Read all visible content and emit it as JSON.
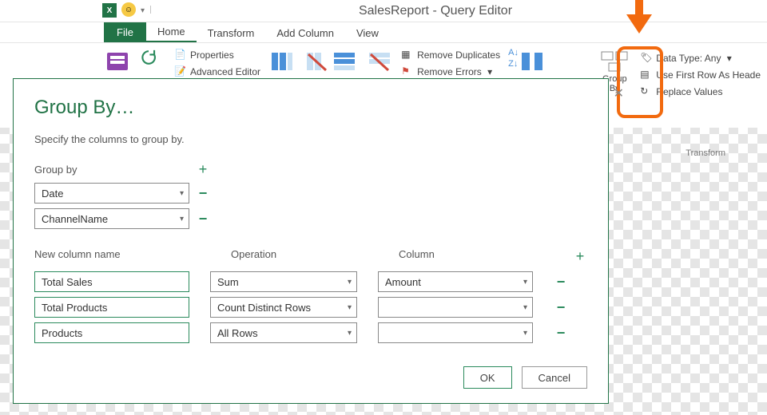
{
  "window": {
    "title": "SalesReport - Query Editor"
  },
  "tabs": {
    "file": "File",
    "home": "Home",
    "transform": "Transform",
    "add_column": "Add Column",
    "view": "View"
  },
  "ribbon": {
    "properties": "Properties",
    "advanced_editor": "Advanced Editor",
    "remove_duplicates": "Remove Duplicates",
    "remove_errors": "Remove Errors",
    "group_by": "Group\nBy",
    "data_type": "Data Type: Any",
    "use_first_row": "Use First Row As Heade",
    "replace_values": "Replace Values",
    "transform_group": "Transform"
  },
  "dialog": {
    "title": "Group By…",
    "subtitle": "Specify the columns to group by.",
    "group_by_label": "Group by",
    "group_cols": [
      "Date",
      "ChannelName"
    ],
    "agg_headers": {
      "name": "New column name",
      "op": "Operation",
      "col": "Column"
    },
    "agg_rows": [
      {
        "name": "Total Sales",
        "op": "Sum",
        "col": "Amount"
      },
      {
        "name": "Total Products",
        "op": "Count Distinct Rows",
        "col": ""
      },
      {
        "name": "Products",
        "op": "All Rows",
        "col": ""
      }
    ],
    "ok": "OK",
    "cancel": "Cancel"
  }
}
